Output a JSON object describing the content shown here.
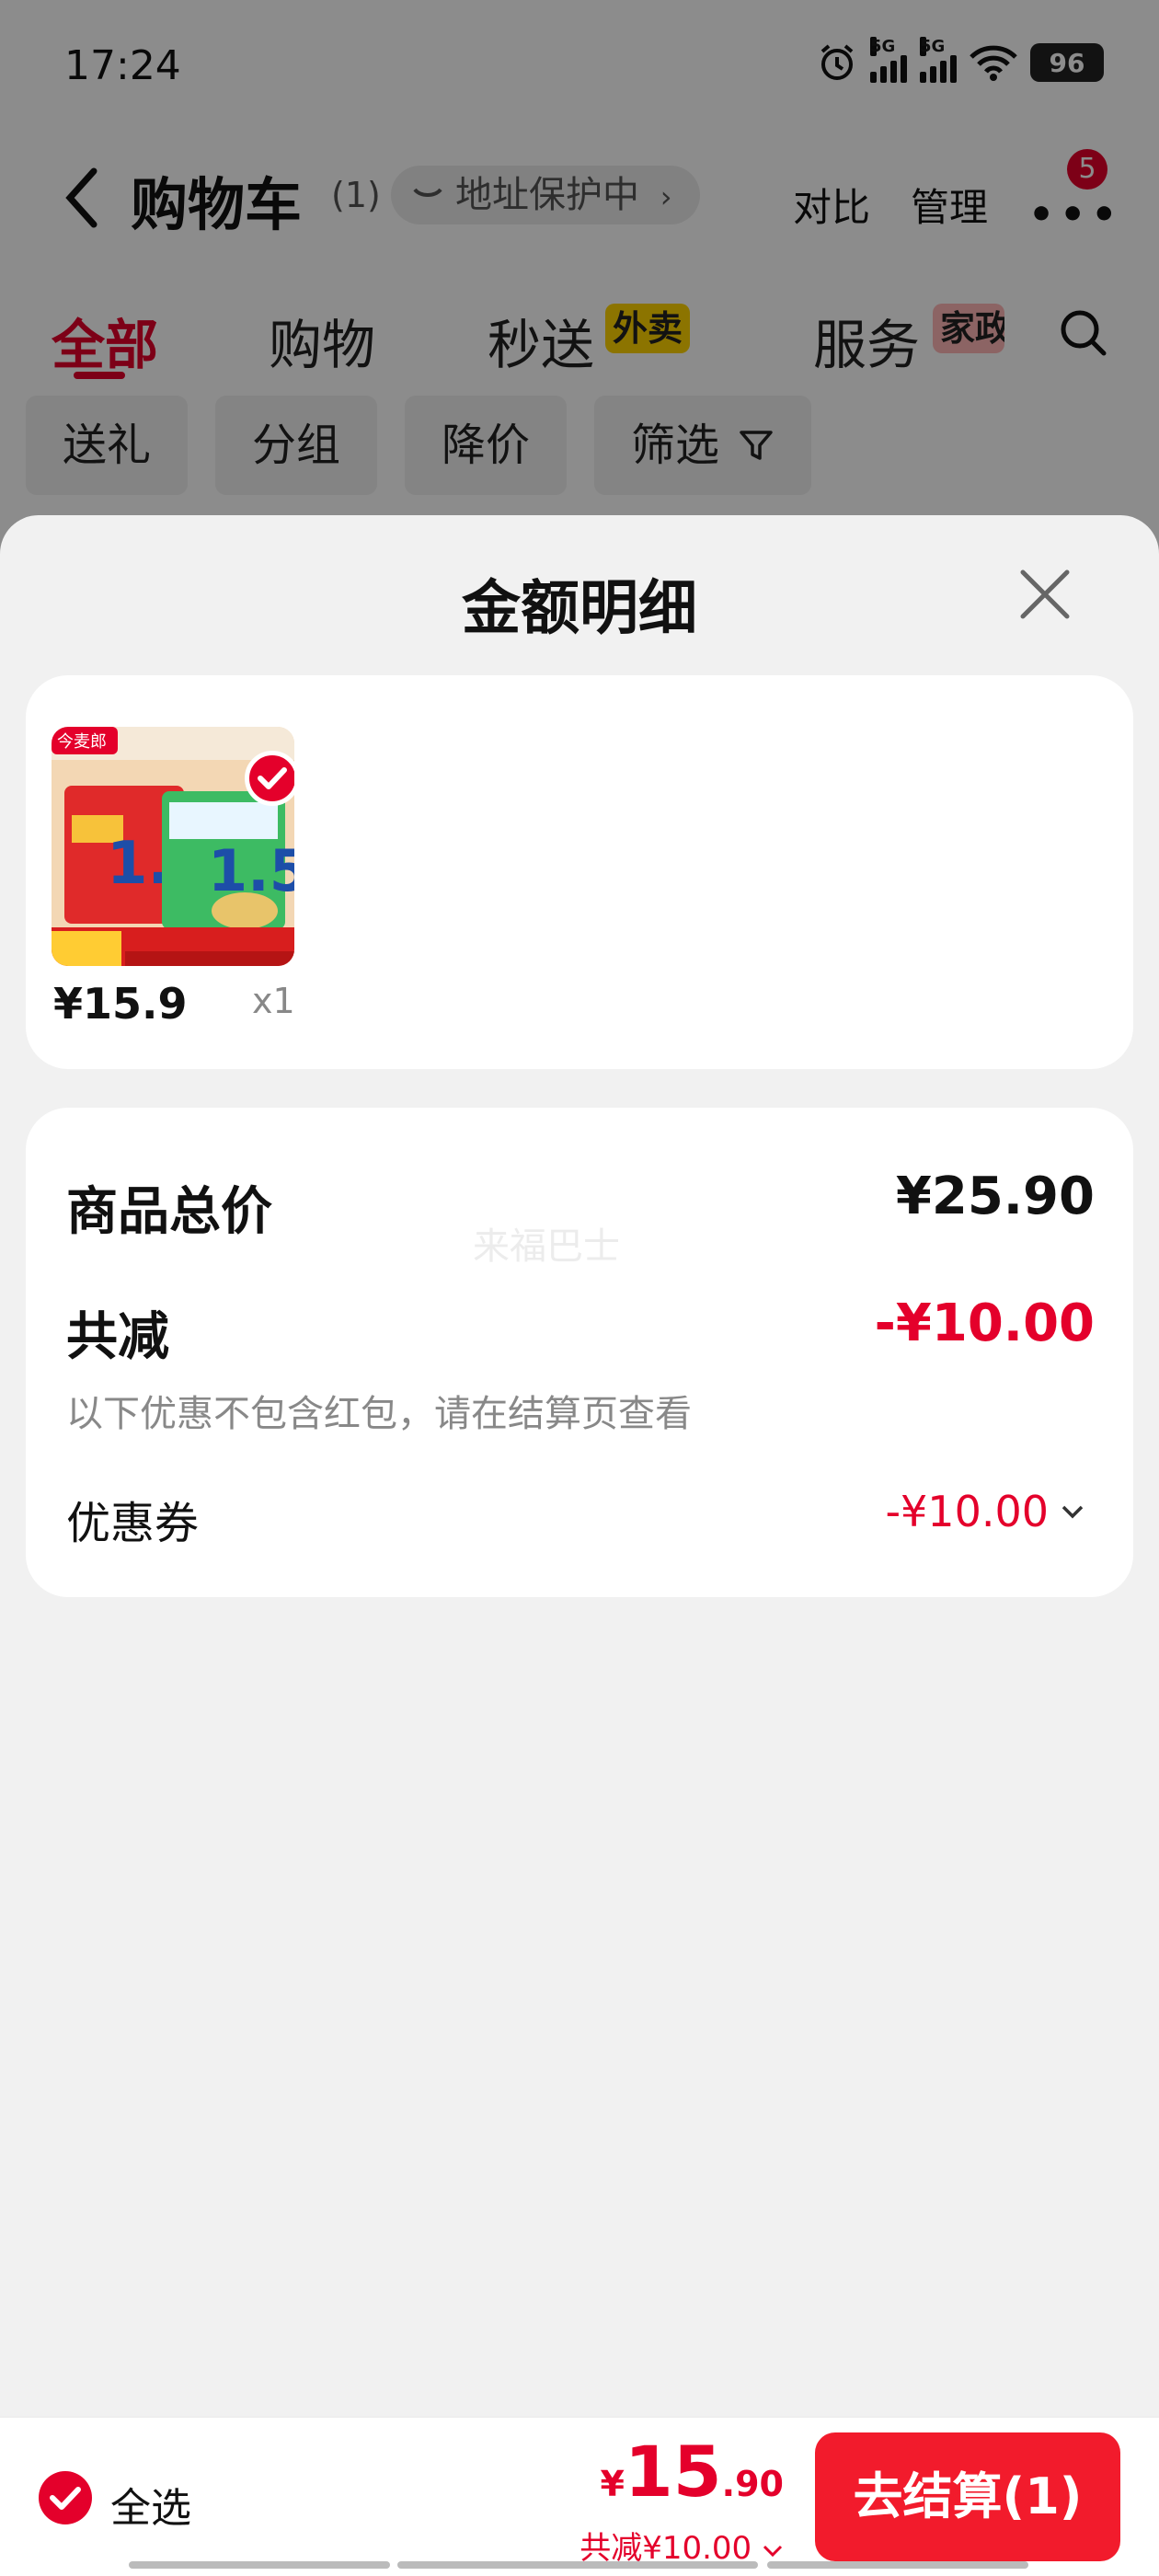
{
  "status_bar": {
    "time": "17:24",
    "network_1": "5G",
    "network_2": "5G",
    "battery": "96"
  },
  "nav": {
    "title": "购物车",
    "count": "(1)",
    "address_protect": "地址保护中",
    "address_chevron": "›",
    "compare": "对比",
    "manage": "管理",
    "more": "•••",
    "more_badge": "5"
  },
  "tabs": {
    "all": "全部",
    "shopping": "购物",
    "instant": "秒送",
    "instant_badge": "外卖",
    "service": "服务",
    "service_badge": "家政"
  },
  "filter_chips": {
    "gift": "送礼",
    "group": "分组",
    "price_drop": "降价",
    "filter": "筛选"
  },
  "sheet": {
    "title": "金额明细",
    "product": {
      "brand_tag": "今麦郎",
      "price": "¥15.9",
      "quantity": "x1"
    },
    "summary": {
      "total_label": "商品总价",
      "total_value": "¥25.90",
      "discount_label": "共减",
      "discount_value": "-¥10.00",
      "note": "以下优惠不包含红包，请在结算页查看",
      "coupon_label": "优惠券",
      "coupon_value": "-¥10.00",
      "watermark": "来福巴士"
    }
  },
  "bottom_bar": {
    "select_all": "全选",
    "currency": "¥",
    "price_int": "15",
    "price_dec": ".90",
    "discount": "共减¥10.00",
    "checkout": "去结算(1)"
  },
  "colors": {
    "accent": "#e4002b",
    "checkout": "#f21b2c"
  }
}
